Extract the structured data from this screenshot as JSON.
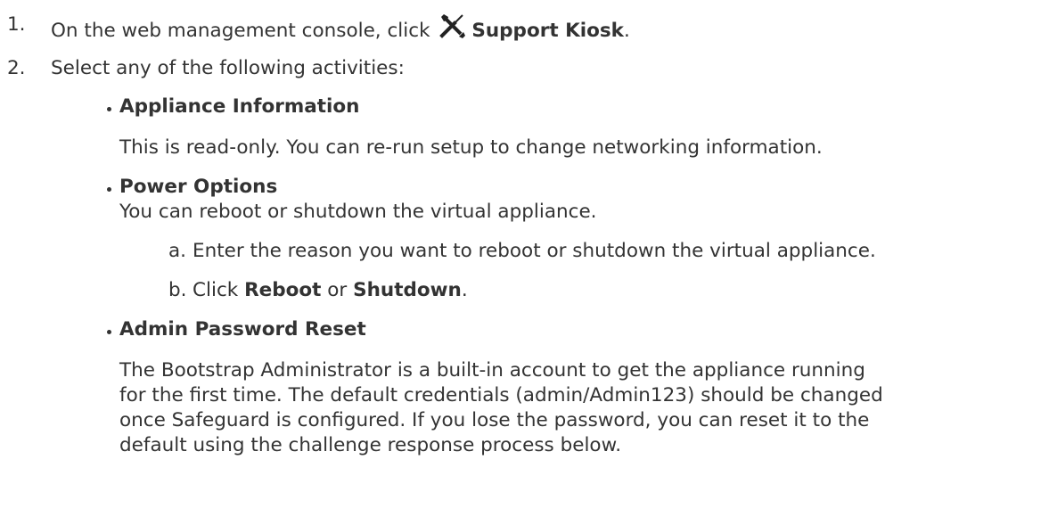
{
  "steps": [
    {
      "number": "1.",
      "text_before": "On the web management console, click",
      "icon": "tools-icon",
      "bold": "Support Kiosk",
      "text_after": "."
    },
    {
      "number": "2.",
      "text": "Select any of the following activities:"
    }
  ],
  "activities": {
    "appliance_information": {
      "title": "Appliance Information",
      "description": "This is read-only. You can re-run setup to change networking information."
    },
    "power_options": {
      "title": "Power Options",
      "description": "You can reboot or shutdown the virtual appliance.",
      "substeps": [
        {
          "letter": "a.",
          "text": "Enter the reason you want to reboot or shutdown the virtual appliance."
        },
        {
          "letter": "b.",
          "text_before": "Click",
          "bold1": "Reboot",
          "middle": "or",
          "bold2": "Shutdown",
          "text_after": "."
        }
      ]
    },
    "admin_password_reset": {
      "title": "Admin Password Reset",
      "description_lines": [
        "The Bootstrap Administrator is a built-in account to get the appliance running",
        "for the first time. The default credentials (admin/Admin123) should be changed",
        "once Safeguard is configured. If you lose the password, you can reset it to the",
        "default using the challenge response process below."
      ]
    }
  }
}
